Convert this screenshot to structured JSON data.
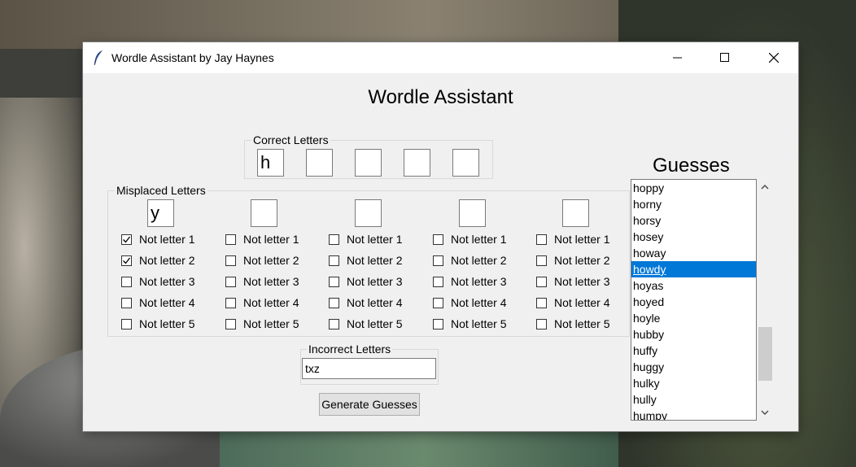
{
  "window": {
    "title": "Wordle Assistant by Jay Haynes"
  },
  "app": {
    "heading": "Wordle Assistant"
  },
  "correct": {
    "label": "Correct Letters",
    "letters": [
      "h",
      "",
      "",
      "",
      ""
    ]
  },
  "misplaced": {
    "label": "Misplaced Letters",
    "letters": [
      "y",
      "",
      "",
      "",
      ""
    ],
    "options": [
      "Not letter 1",
      "Not letter 2",
      "Not letter 3",
      "Not letter 4",
      "Not letter 5"
    ],
    "checked": [
      [
        true,
        true,
        false,
        false,
        false
      ],
      [
        false,
        false,
        false,
        false,
        false
      ],
      [
        false,
        false,
        false,
        false,
        false
      ],
      [
        false,
        false,
        false,
        false,
        false
      ],
      [
        false,
        false,
        false,
        false,
        false
      ]
    ]
  },
  "incorrect": {
    "label": "Incorrect Letters",
    "value": "txz"
  },
  "generate": {
    "label": "Generate Guesses"
  },
  "guesses": {
    "title": "Guesses",
    "items": [
      "hoppy",
      "horny",
      "horsy",
      "hosey",
      "howay",
      "howdy",
      "hoyas",
      "hoyed",
      "hoyle",
      "hubby",
      "huffy",
      "huggy",
      "hulky",
      "hully",
      "humpy"
    ],
    "selected": "howdy",
    "selected_color": "#0078d7"
  }
}
